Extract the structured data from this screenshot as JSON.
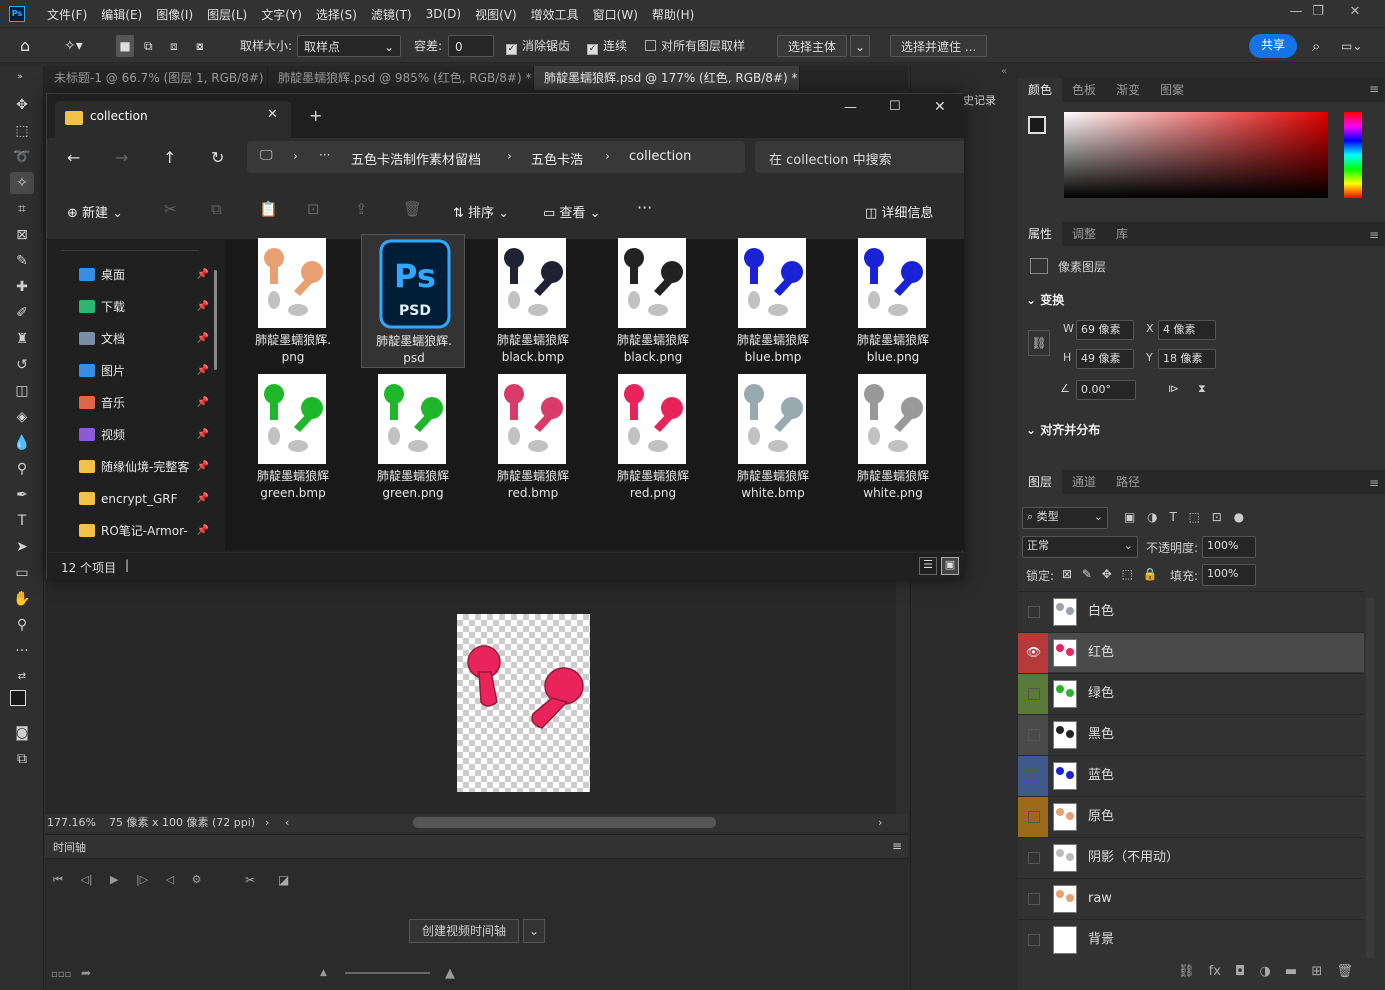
{
  "app": {
    "menu": [
      "文件(F)",
      "编辑(E)",
      "图像(I)",
      "图层(L)",
      "文字(Y)",
      "选择(S)",
      "滤镜(T)",
      "3D(D)",
      "视图(V)",
      "增效工具",
      "窗口(W)",
      "帮助(H)"
    ],
    "logo": "Ps"
  },
  "options": {
    "sample_size_label": "取样大小:",
    "sample_size_value": "取样点",
    "tolerance_label": "容差:",
    "tolerance_value": "0",
    "antialias": "消除锯齿",
    "contiguous": "连续",
    "all_layers": "对所有图层取样",
    "select_subject": "选择主体",
    "select_mask": "选择并遮住 ...",
    "share": "共享"
  },
  "doc_tabs": [
    "未标题-1 @ 66.7% (图层 1, RGB/8#)",
    "肺靛墨蠕狼辉.psd @ 985% (红色, RGB/8#) *",
    "肺靛墨蠕狼辉.psd @ 177% (红色, RGB/8#) *"
  ],
  "status": {
    "zoom": "177.16%",
    "docinfo": "75 像素 x 100 像素 (72 ppi)"
  },
  "timeline": {
    "title": "时间轴",
    "create_button": "创建视频时间轴"
  },
  "right": {
    "color_tabs": [
      "颜色",
      "色板",
      "渐变",
      "图案"
    ],
    "prop_tabs": [
      "属性",
      "调整",
      "库"
    ],
    "prop_type": "像素图层",
    "transform_title": "变换",
    "w_label": "W",
    "w_value": "69 像素",
    "x_label": "X",
    "x_value": "4 像素",
    "h_label": "H",
    "h_value": "49 像素",
    "y_label": "Y",
    "y_value": "18 像素",
    "angle": "0.00°",
    "align_title": "对齐并分布",
    "layer_tabs": [
      "图层",
      "通道",
      "路径"
    ],
    "filter": "类型",
    "blend": "正常",
    "opacity_label": "不透明度:",
    "opacity_value": "100%",
    "lock_label": "锁定:",
    "fill_label": "填充:",
    "fill_value": "100%",
    "history_label": "史记录",
    "layers": [
      {
        "name": "白色",
        "tag": "",
        "visible": false,
        "thumb": "#9aa3a8"
      },
      {
        "name": "红色",
        "tag": "#b53a3a",
        "visible": true,
        "thumb": "#e8245a"
      },
      {
        "name": "绿色",
        "tag": "#5a7a3a",
        "visible": false,
        "thumb": "#1fb82a"
      },
      {
        "name": "黑色",
        "tag": "#4a4a4a",
        "visible": false,
        "thumb": "#222222"
      },
      {
        "name": "蓝色",
        "tag": "#3f5a8a",
        "visible": false,
        "thumb": "#1a22d8"
      },
      {
        "name": "原色",
        "tag": "#9a6a1a",
        "visible": false,
        "thumb": "#e8a070"
      },
      {
        "name": "阴影（不用动）",
        "tag": "",
        "visible": false,
        "thumb": "#bbbbbb"
      },
      {
        "name": "raw",
        "tag": "",
        "visible": false,
        "thumb": "#e8a070"
      },
      {
        "name": "背景",
        "tag": "",
        "visible": false,
        "thumb": "#ffffff"
      }
    ]
  },
  "explorer": {
    "tab_title": "collection",
    "breadcrumb": [
      "五色卡浩制作素材留档",
      "五色卡浩",
      "collection"
    ],
    "search_placeholder": "在 collection 中搜索",
    "cmd_new": "新建",
    "cmd_sort": "排序",
    "cmd_view": "查看",
    "cmd_details": "详细信息",
    "status": "12 个项目",
    "sidebar": [
      {
        "label": "桌面",
        "color": "#3a8ee6"
      },
      {
        "label": "下载",
        "color": "#2bb673"
      },
      {
        "label": "文档",
        "color": "#7a8da8"
      },
      {
        "label": "图片",
        "color": "#3a8ee6"
      },
      {
        "label": "音乐",
        "color": "#e0664a"
      },
      {
        "label": "视频",
        "color": "#8a5ad8"
      },
      {
        "label": "随缘仙境-完整客",
        "color": "#f2c14a"
      },
      {
        "label": "encrypt_GRF",
        "color": "#f2c14a"
      },
      {
        "label": "RO笔记-Armor-",
        "color": "#f2c14a"
      }
    ],
    "files": [
      {
        "line1": "肺靛墨蠕狼辉.",
        "line2": "png",
        "color": "#e8a070",
        "psd": false,
        "selected": false
      },
      {
        "line1": "肺靛墨蠕狼辉.",
        "line2": "psd",
        "color": "",
        "psd": true,
        "selected": true
      },
      {
        "line1": "肺靛墨蠕狼辉",
        "line2": "black.bmp",
        "color": "#1e2233",
        "psd": false,
        "selected": false
      },
      {
        "line1": "肺靛墨蠕狼辉",
        "line2": "black.png",
        "color": "#222222",
        "psd": false,
        "selected": false
      },
      {
        "line1": "肺靛墨蠕狼辉",
        "line2": "blue.bmp",
        "color": "#1a22d8",
        "psd": false,
        "selected": false
      },
      {
        "line1": "肺靛墨蠕狼辉",
        "line2": "blue.png",
        "color": "#1a22d8",
        "psd": false,
        "selected": false
      },
      {
        "line1": "肺靛墨蠕狼辉",
        "line2": "green.bmp",
        "color": "#1fb82a",
        "psd": false,
        "selected": false
      },
      {
        "line1": "肺靛墨蠕狼辉",
        "line2": "green.png",
        "color": "#1fb82a",
        "psd": false,
        "selected": false
      },
      {
        "line1": "肺靛墨蠕狼辉",
        "line2": "red.bmp",
        "color": "#d83a6a",
        "psd": false,
        "selected": false
      },
      {
        "line1": "肺靛墨蠕狼辉",
        "line2": "red.png",
        "color": "#e8245a",
        "psd": false,
        "selected": false
      },
      {
        "line1": "肺靛墨蠕狼辉",
        "line2": "white.bmp",
        "color": "#9aa8b0",
        "psd": false,
        "selected": false
      },
      {
        "line1": "肺靛墨蠕狼辉",
        "line2": "white.png",
        "color": "#999999",
        "psd": false,
        "selected": false
      }
    ],
    "psd_label": "Ps",
    "psd_sub": "PSD"
  }
}
